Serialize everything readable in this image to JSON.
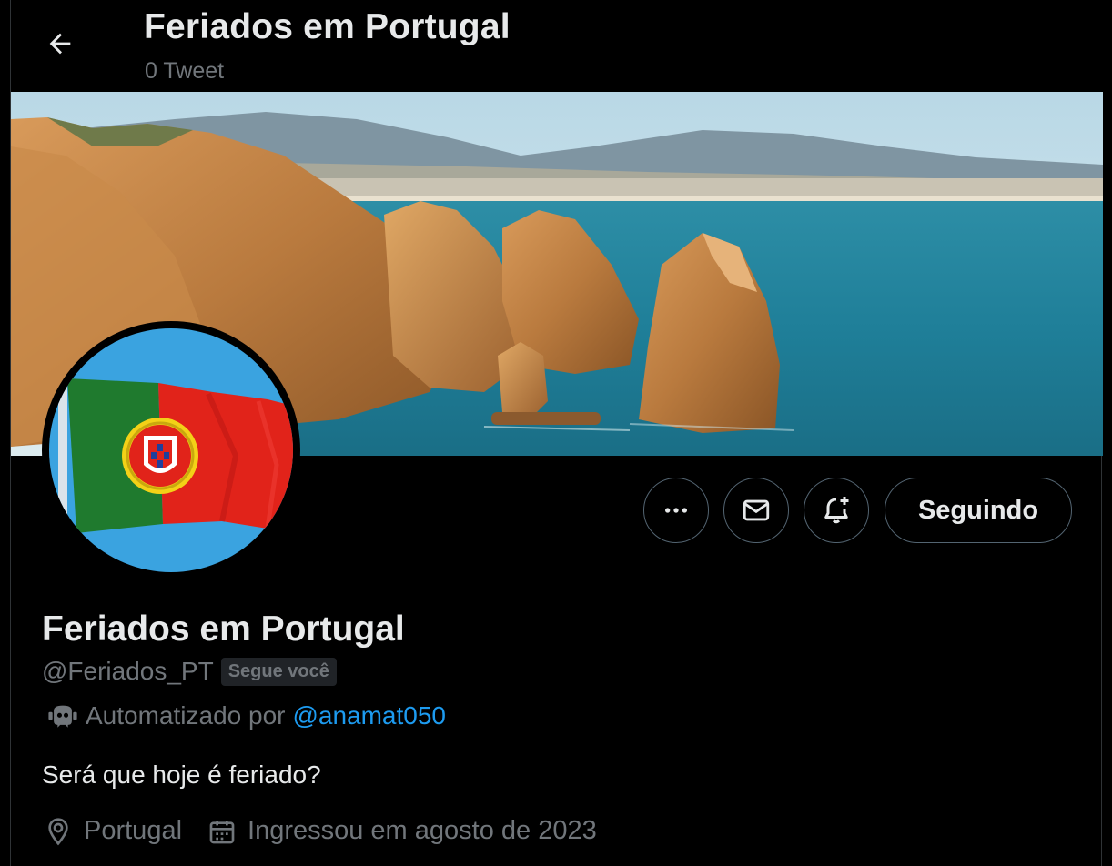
{
  "header": {
    "title": "Feriados em Portugal",
    "tweet_count": "0 Tweet"
  },
  "actions": {
    "more_icon": "more-horizontal-icon",
    "message_icon": "envelope-icon",
    "notify_icon": "bell-plus-icon",
    "follow_label": "Seguindo"
  },
  "profile": {
    "display_name": "Feriados em Portugal",
    "handle": "@Feriados_PT",
    "follows_you_badge": "Segue você",
    "automated_prefix": "Automatizado por",
    "automated_by": "@anamat050",
    "bio": "Será que hoje é feriado?",
    "location": "Portugal",
    "joined": "Ingressou em agosto de 2023"
  },
  "colors": {
    "background": "#000000",
    "text_primary": "#e7e9ea",
    "text_secondary": "#71767b",
    "link": "#1d9bf0",
    "border": "#536471"
  }
}
